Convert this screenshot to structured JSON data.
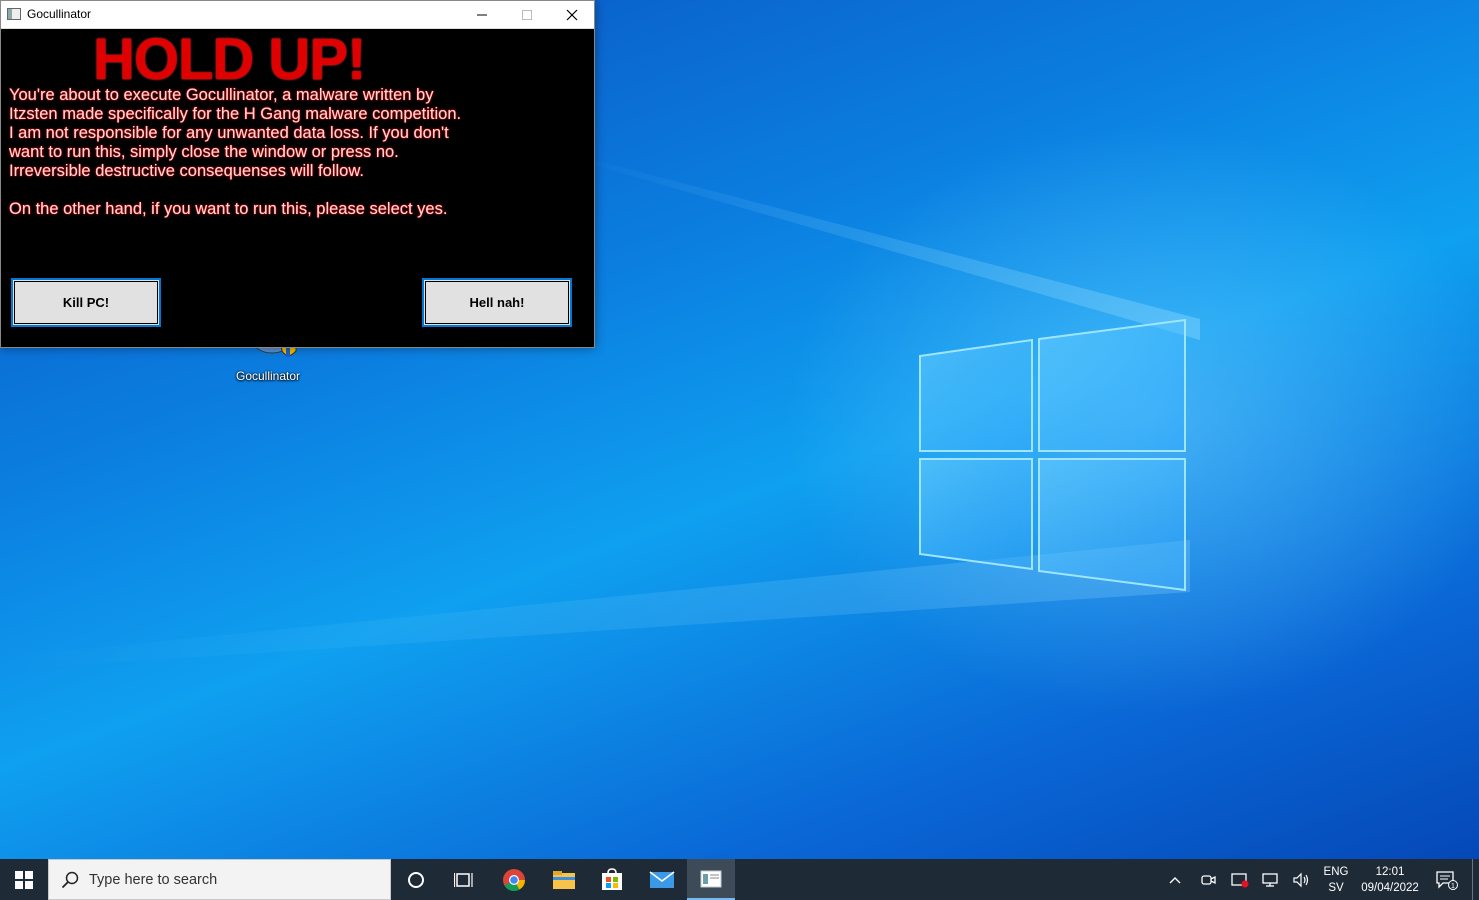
{
  "window": {
    "title": "Gocullinator",
    "headline": "HOLD UP!",
    "message": "You're about to execute Gocullinator, a malware written by\nItzsten made specifically for the H Gang malware competition.\nI am not responsible for any unwanted data loss. If you don't\nwant to run this, simply close the window or press no.\nIrreversible destructive consequenses will follow.\n\nOn the other hand, if you want to run this, please select yes.",
    "kill_button": "Kill PC!",
    "nah_button": "Hell nah!"
  },
  "desktop": {
    "icon_label": "Gocullinator"
  },
  "taskbar": {
    "search_placeholder": "Type here to search",
    "language_top": "ENG",
    "language_bottom": "SV",
    "time": "12:01",
    "date": "09/04/2022",
    "notification_count": "1"
  },
  "colors": {
    "headline": "#e00000",
    "accent": "#0078d7",
    "taskbar": "#1f2a37"
  }
}
